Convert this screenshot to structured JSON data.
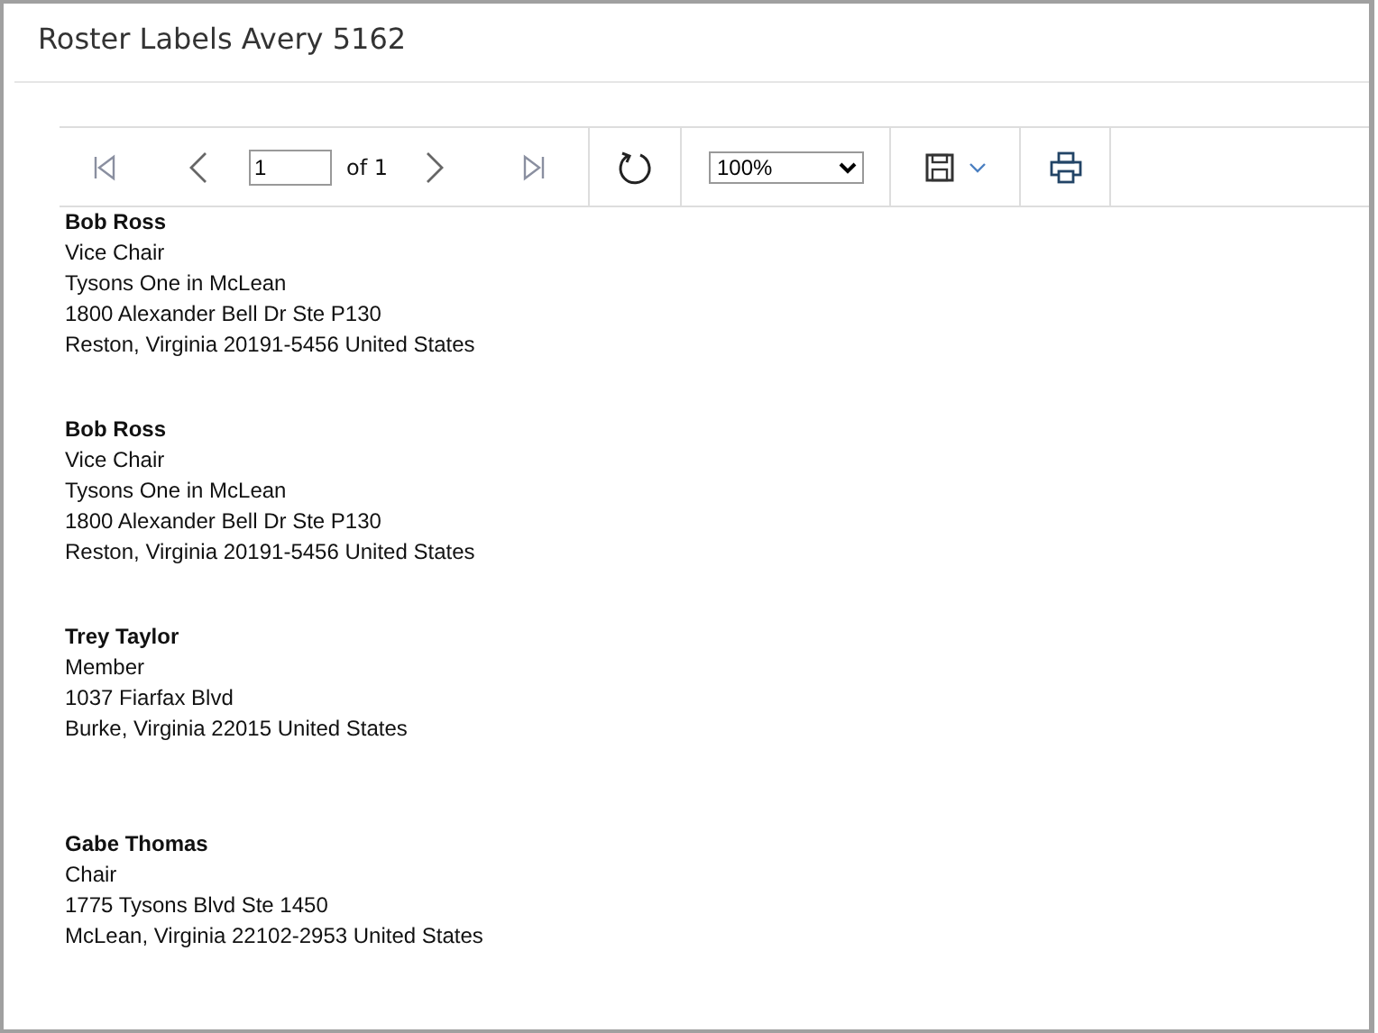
{
  "window": {
    "title": "Roster Labels Avery 5162"
  },
  "toolbar": {
    "page_input": "1",
    "page_count": "of 1",
    "zoom": "100%"
  },
  "labels": [
    {
      "name": "Bob Ross",
      "lines": [
        "Vice Chair",
        "Tysons One in McLean",
        "1800 Alexander Bell Dr Ste P130",
        "Reston, Virginia 20191-5456 United States"
      ]
    },
    {
      "name": "Bob Ross",
      "lines": [
        "Vice Chair",
        "Tysons One in McLean",
        "1800 Alexander Bell Dr Ste P130",
        "Reston, Virginia 20191-5456 United States"
      ]
    },
    {
      "name": "Trey Taylor",
      "lines": [
        "Member",
        "1037 Fiarfax Blvd",
        "Burke, Virginia 22015 United States"
      ]
    },
    {
      "name": "Gabe Thomas",
      "lines": [
        "Chair",
        "1775 Tysons Blvd Ste 1450",
        "McLean, Virginia 22102-2953 United States"
      ]
    }
  ]
}
